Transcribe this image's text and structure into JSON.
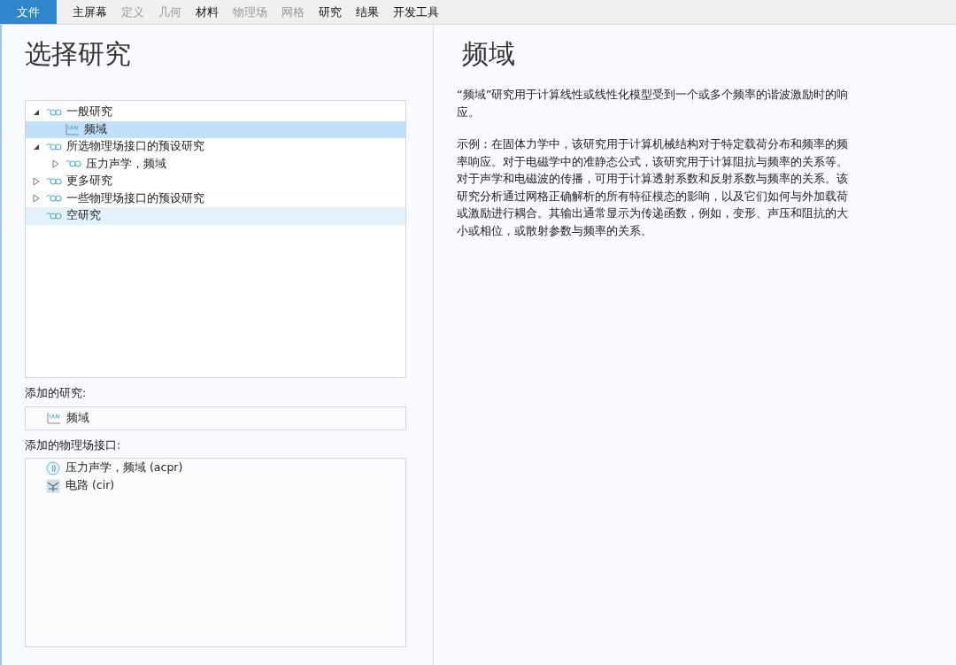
{
  "menu": [
    {
      "label": "文件",
      "selected": true,
      "disabled": false
    },
    {
      "label": "主屏幕",
      "selected": false,
      "disabled": false
    },
    {
      "label": "定义",
      "selected": false,
      "disabled": true
    },
    {
      "label": "几何",
      "selected": false,
      "disabled": true
    },
    {
      "label": "材料",
      "selected": false,
      "disabled": false
    },
    {
      "label": "物理场",
      "selected": false,
      "disabled": true
    },
    {
      "label": "网格",
      "selected": false,
      "disabled": true
    },
    {
      "label": "研究",
      "selected": false,
      "disabled": false
    },
    {
      "label": "结果",
      "selected": false,
      "disabled": false
    },
    {
      "label": "开发工具",
      "selected": false,
      "disabled": false
    }
  ],
  "left": {
    "title": "选择研究",
    "tree": [
      {
        "label": "一般研究",
        "kind": "study",
        "expanded": true,
        "selected": false,
        "highlighted": false,
        "children": [
          {
            "label": "频域",
            "kind": "frequency",
            "selected": true,
            "highlighted": false
          }
        ]
      },
      {
        "label": "所选物理场接口的预设研究",
        "kind": "study",
        "expanded": true,
        "selected": false,
        "highlighted": false,
        "children": [
          {
            "label": "压力声学，频域",
            "kind": "study",
            "expanded": false,
            "selected": false,
            "highlighted": false
          }
        ]
      },
      {
        "label": "更多研究",
        "kind": "study",
        "expanded": false,
        "selected": false,
        "highlighted": false
      },
      {
        "label": "一些物理场接口的预设研究",
        "kind": "study",
        "expanded": false,
        "selected": false,
        "highlighted": false
      },
      {
        "label": "空研究",
        "kind": "study",
        "selected": false,
        "highlighted": true
      }
    ],
    "added_studies_label": "添加的研究:",
    "added_studies": [
      {
        "label": "频域",
        "kind": "frequency"
      }
    ],
    "added_physics_label": "添加的物理场接口:",
    "added_physics": [
      {
        "label": "压力声学，频域 (acpr)",
        "kind": "acoustics"
      },
      {
        "label": "电路 (cir)",
        "kind": "circuit"
      }
    ]
  },
  "right": {
    "title": "频域",
    "paragraphs": [
      "“频域”研究用于计算线性或线性化模型受到一个或多个频率的谐波激励时的响应。",
      "示例：在固体力学中，该研究用于计算机械结构对于特定载荷分布和频率的频率响应。对于电磁学中的准静态公式，该研究用于计算阻抗与频率的关系等。对于声学和电磁波的传播，可用于计算透射系数和反射系数与频率的关系。该研究分析通过网格正确解析的所有特征模态的影响，以及它们如何与外加载荷或激励进行耦合。其输出通常显示为传递函数，例如，变形、声压和阻抗的大小或相位，或散射参数与频率的关系。"
    ]
  }
}
